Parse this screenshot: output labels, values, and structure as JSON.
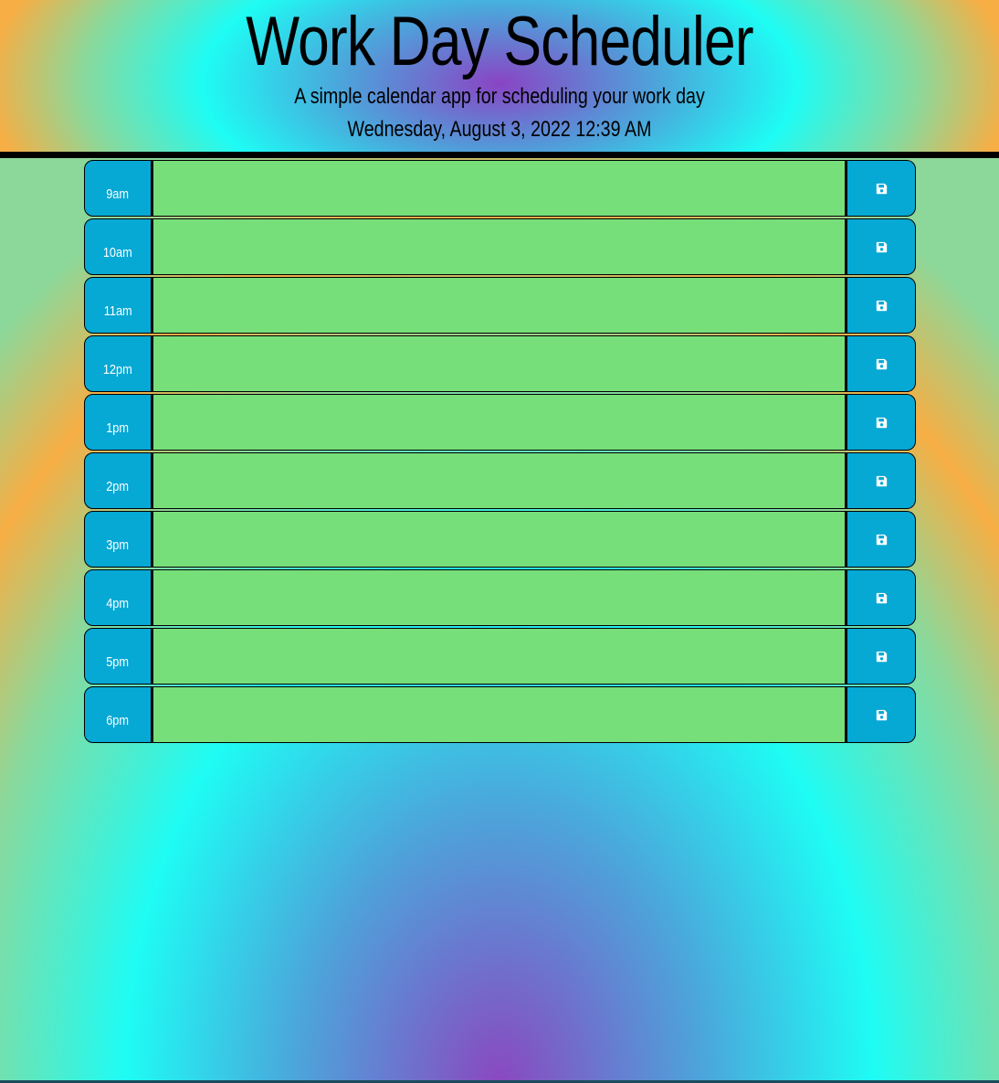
{
  "header": {
    "title": "Work Day Scheduler",
    "subtitle": "A simple calendar app for scheduling your work day",
    "current_day": "Wednesday, August 3, 2022 12:39 AM"
  },
  "colors": {
    "time_block_blue": "#06a8d4",
    "future_green": "#77df7a",
    "border_black": "#000000"
  },
  "time_blocks": [
    {
      "hour": "9am",
      "text": ""
    },
    {
      "hour": "10am",
      "text": ""
    },
    {
      "hour": "11am",
      "text": ""
    },
    {
      "hour": "12pm",
      "text": ""
    },
    {
      "hour": "1pm",
      "text": ""
    },
    {
      "hour": "2pm",
      "text": ""
    },
    {
      "hour": "3pm",
      "text": ""
    },
    {
      "hour": "4pm",
      "text": ""
    },
    {
      "hour": "5pm",
      "text": ""
    },
    {
      "hour": "6pm",
      "text": ""
    }
  ],
  "icons": {
    "save": "floppy-disk-icon"
  }
}
